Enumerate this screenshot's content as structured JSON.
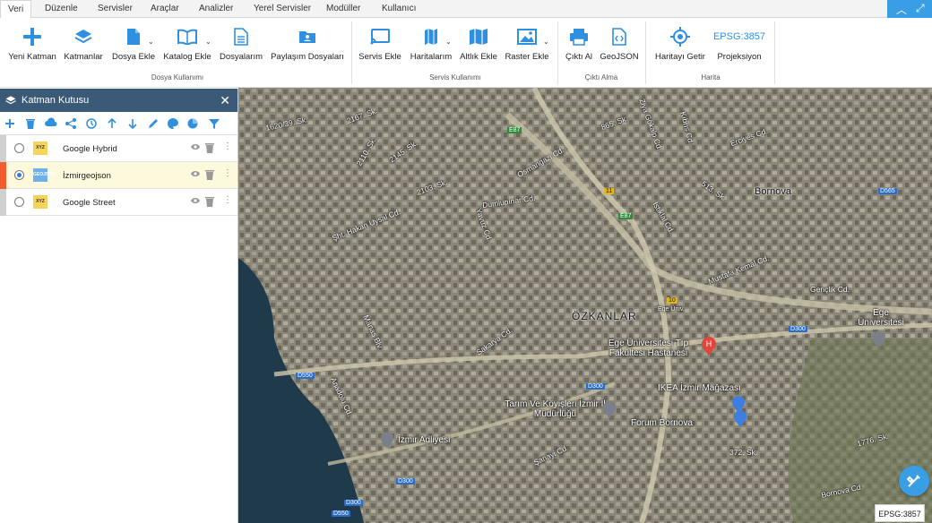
{
  "tabs": [
    "Veri",
    "Düzenle",
    "Servisler",
    "Araçlar",
    "Analizler",
    "Yerel Servisler",
    "Modüller",
    "Kullanıcı"
  ],
  "ribbon": {
    "yeni_katman": "Yeni Katman",
    "katmanlar": "Katmanlar",
    "dosya_ekle": "Dosya Ekle",
    "katalog_ekle": "Katalog Ekle",
    "dosyalarim": "Dosyalarım",
    "paylasim": "Paylaşım Dosyaları",
    "servis_ekle": "Servis Ekle",
    "haritalarim": "Haritalarım",
    "altlik_ekle": "Altlık Ekle",
    "raster_ekle": "Raster Ekle",
    "cikti_al": "Çıktı Al",
    "geojson": "GeoJSON",
    "haritayi_getir": "Haritayı Getir",
    "epsg": "EPSG:3857",
    "projeksiyon": "Projeksiyon",
    "group_dosya": "Dosya Kullanımı",
    "group_servis": "Servis Kullanımı",
    "group_cikti": "Çıktı Alma",
    "group_harita": "Harita"
  },
  "panel": {
    "title": "Katman Kutusu",
    "layers": [
      {
        "name": "Google Hybrid",
        "badge": "XYZ",
        "selected": false
      },
      {
        "name": "İzmirgeojson",
        "badge": "GEOJSON",
        "selected": true
      },
      {
        "name": "Google Street",
        "badge": "XYZ",
        "selected": false
      }
    ]
  },
  "map": {
    "district_labels": [
      "ÖZKANLAR",
      "Bornova"
    ],
    "poi_labels": [
      "Ege Üniversitesi Tıp Fakültesi Hastanesi",
      "IKEA İzmir Mağazası",
      "Forum Bornova",
      "Tarım Ve Köyişleri İzmir İl Müdürlüğü",
      "İzmir Adliyesi",
      "Ege Üniversitesi",
      "Gençlik Cd."
    ],
    "street_labels": [
      "1620/39. Sk.",
      "2167. Sk.",
      "2110. Sk.",
      "2145. Sk.",
      "2103. Sk.",
      "Şht. Hakan Uysal Cd.",
      "Dumlupınar Cd.",
      "Yavuz Cd.",
      "Osmangazi Cd.",
      "865. Sk.",
      "Ziya Gökalp Cd.",
      "Kıbrıs Cd.",
      "Erciyes Cd.",
      "513. Sk.",
      "İstiklal Cd.",
      "Mustafa Kemal Cd.",
      "Sakarya Cd.",
      "Manas Blv.",
      "Anadolu Cd.",
      "Şanayi Cd.",
      "Bornova Cd.",
      "372. Sk.",
      "1776. Sk.",
      "Ege Üniv."
    ],
    "road_signs": [
      "E87",
      "E87",
      "D565",
      "D300",
      "D300",
      "D300",
      "D550",
      "D550",
      "D300",
      "11",
      "10"
    ],
    "epsg_badge": "EPSG:3857"
  }
}
